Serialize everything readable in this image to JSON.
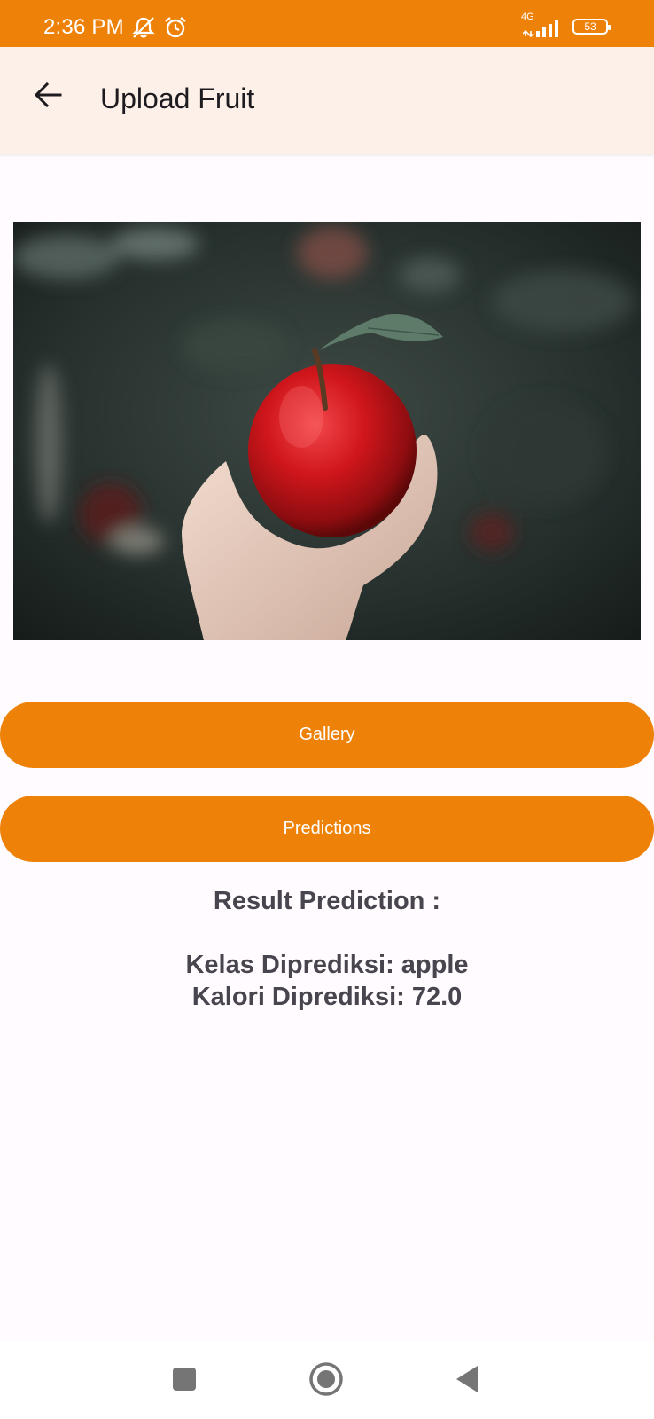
{
  "status_bar": {
    "time": "2:36 PM",
    "network_label": "4G",
    "battery_level": "53",
    "icons": [
      "mute-notifications-icon",
      "alarm-icon",
      "signal-icon",
      "battery-icon"
    ],
    "background_color": "#ee8209"
  },
  "app_bar": {
    "title": "Upload Fruit",
    "back_icon": "arrow-back-icon",
    "background_color": "#fdf0e9"
  },
  "image": {
    "subject": "hand-holding-red-apple"
  },
  "buttons": {
    "gallery_label": "Gallery",
    "predictions_label": "Predictions",
    "color": "#ee8209"
  },
  "result": {
    "title": "Result Prediction :",
    "class_line": "Kelas Diprediksi: apple",
    "calorie_line": "Kalori Diprediksi: 72.0"
  },
  "nav_bar": {
    "icons": [
      "recents-icon",
      "home-icon",
      "back-icon"
    ]
  }
}
